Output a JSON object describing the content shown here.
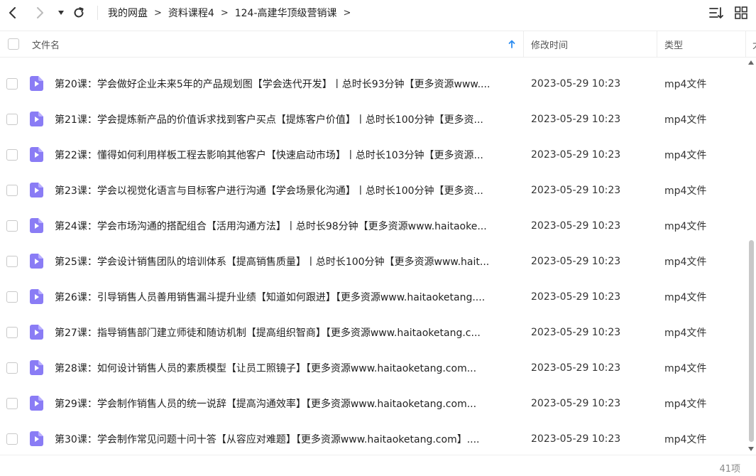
{
  "breadcrumb": [
    "我的网盘",
    "资料课程4",
    "124-高建华顶级营销课"
  ],
  "breadcrumb_separator": ">",
  "columns": {
    "name": "文件名",
    "modified": "修改时间",
    "type": "类型",
    "size_partial": "大"
  },
  "sort": {
    "column": "文件名",
    "direction": "ascending"
  },
  "files": [
    {
      "name": "第20课：学会做好企业未来5年的产品规划图【学会迭代开发】丨总时长93分钟【更多资源www....",
      "modified": "2023-05-29 10:23",
      "type": "mp4文件"
    },
    {
      "name": "第21课：学会提炼新产品的价值诉求找到客户买点【提炼客户价值】丨总时长100分钟【更多资...",
      "modified": "2023-05-29 10:23",
      "type": "mp4文件"
    },
    {
      "name": "第22课：懂得如何利用样板工程去影响其他客户【快速启动市场】丨总时长103分钟【更多资源...",
      "modified": "2023-05-29 10:23",
      "type": "mp4文件"
    },
    {
      "name": "第23课：学会以视觉化语言与目标客户进行沟通【学会场景化沟通】丨总时长100分钟【更多资...",
      "modified": "2023-05-29 10:23",
      "type": "mp4文件"
    },
    {
      "name": "第24课：学会市场沟通的搭配组合【活用沟通方法】丨总时长98分钟【更多资源www.haitaoke...",
      "modified": "2023-05-29 10:23",
      "type": "mp4文件"
    },
    {
      "name": "第25课：学会设计销售团队的培训体系【提高销售质量】丨总时长100分钟【更多资源www.hait...",
      "modified": "2023-05-29 10:23",
      "type": "mp4文件"
    },
    {
      "name": "第26课：引导销售人员善用销售漏斗提升业绩【知道如何跟进】【更多资源www.haitaoketang....",
      "modified": "2023-05-29 10:23",
      "type": "mp4文件"
    },
    {
      "name": "第27课：指导销售部门建立师徒和随访机制【提高组织智商】【更多资源www.haitaoketang.c...",
      "modified": "2023-05-29 10:23",
      "type": "mp4文件"
    },
    {
      "name": "第28课：如何设计销售人员的素质模型【让员工照镜子】【更多资源www.haitaoketang.com...",
      "modified": "2023-05-29 10:23",
      "type": "mp4文件"
    },
    {
      "name": "第29课：学会制作销售人员的统一说辞【提高沟通效率】【更多资源www.haitaoketang.com...",
      "modified": "2023-05-29 10:23",
      "type": "mp4文件"
    },
    {
      "name": "第30课：学会制作常见问题十问十答【从容应对难题】【更多资源www.haitaoketang.com】....",
      "modified": "2023-05-29 10:23",
      "type": "mp4文件"
    }
  ],
  "footer": {
    "count": "41项"
  },
  "colors": {
    "accent": "#2c8cf0",
    "file_icon": "#8a7cf5",
    "text": "#222222",
    "muted": "#888888"
  },
  "icons": {
    "back": "chevron-left-icon",
    "forward": "chevron-right-icon",
    "history": "caret-down-icon",
    "refresh": "refresh-icon",
    "sort_arrow": "arrow-up-icon",
    "sort_menu": "sort-list-icon",
    "view_mode": "grid-view-icon",
    "file": "video-file-icon"
  }
}
